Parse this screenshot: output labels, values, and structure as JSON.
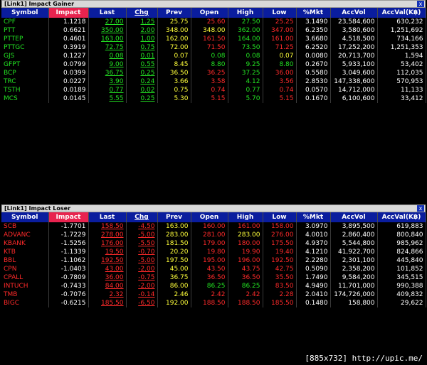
{
  "gainer": {
    "title": "[Link1] Impact Gainer",
    "close": "x",
    "headers": [
      "Symbol",
      "Impact",
      "Last",
      "Chg",
      "Prev",
      "Open",
      "High",
      "Low",
      "%Mkt",
      "AccVol",
      "AccVal(K฿)"
    ],
    "rows": [
      {
        "symbol": "CPF",
        "impact": "1.1218",
        "last": "27.00",
        "chg": "1.25",
        "prev": "25.75",
        "open": "25.60",
        "high": "27.50",
        "low": "25.25",
        "mkt": "3.1490",
        "accvol": "23,584,600",
        "accval": "630,232",
        "last_color": "green",
        "open_color": "red",
        "high_color": "green",
        "low_color": "red"
      },
      {
        "symbol": "PTT",
        "impact": "0.6621",
        "last": "350.00",
        "chg": "2.00",
        "prev": "348.00",
        "open": "348.00",
        "high": "362.00",
        "low": "347.00",
        "mkt": "6.2350",
        "accvol": "3,580,600",
        "accval": "1,251,692",
        "last_color": "green",
        "open_color": "yellow",
        "high_color": "green",
        "low_color": "red"
      },
      {
        "symbol": "PTTEP",
        "impact": "0.4601",
        "last": "163.00",
        "chg": "1.00",
        "prev": "162.00",
        "open": "161.50",
        "high": "164.00",
        "low": "161.00",
        "mkt": "3.6680",
        "accvol": "4,518,500",
        "accval": "734,166",
        "last_color": "green",
        "open_color": "red",
        "high_color": "green",
        "low_color": "red"
      },
      {
        "symbol": "PTTGC",
        "impact": "0.3919",
        "last": "72.75",
        "chg": "0.75",
        "prev": "72.00",
        "open": "71.50",
        "high": "73.50",
        "low": "71.25",
        "mkt": "6.2520",
        "accvol": "17,252,200",
        "accval": "1,251,353",
        "last_color": "green",
        "open_color": "red",
        "high_color": "green",
        "low_color": "red"
      },
      {
        "symbol": "GJS",
        "impact": "0.1227",
        "last": "0.08",
        "chg": "0.01",
        "prev": "0.07",
        "open": "0.08",
        "high": "0.08",
        "low": "0.07",
        "mkt": "0.0080",
        "accvol": "20,713,700",
        "accval": "1,594",
        "last_color": "green",
        "open_color": "green",
        "high_color": "green",
        "low_color": "yellow"
      },
      {
        "symbol": "GFPT",
        "impact": "0.0799",
        "last": "9.00",
        "chg": "0.55",
        "prev": "8.45",
        "open": "8.80",
        "high": "9.25",
        "low": "8.80",
        "mkt": "0.2670",
        "accvol": "5,933,100",
        "accval": "53,402",
        "last_color": "green",
        "open_color": "green",
        "high_color": "green",
        "low_color": "green"
      },
      {
        "symbol": "BCP",
        "impact": "0.0399",
        "last": "36.75",
        "chg": "0.25",
        "prev": "36.50",
        "open": "36.25",
        "high": "37.25",
        "low": "36.00",
        "mkt": "0.5580",
        "accvol": "3,049,600",
        "accval": "112,035",
        "last_color": "green",
        "open_color": "red",
        "high_color": "green",
        "low_color": "red"
      },
      {
        "symbol": "TRC",
        "impact": "0.0227",
        "last": "3.90",
        "chg": "0.24",
        "prev": "3.66",
        "open": "3.58",
        "high": "4.12",
        "low": "3.56",
        "mkt": "2.8530",
        "accvol": "147,338,600",
        "accval": "570,953",
        "last_color": "green",
        "open_color": "red",
        "high_color": "green",
        "low_color": "red"
      },
      {
        "symbol": "TSTH",
        "impact": "0.0189",
        "last": "0.77",
        "chg": "0.02",
        "prev": "0.75",
        "open": "0.74",
        "high": "0.77",
        "low": "0.74",
        "mkt": "0.0570",
        "accvol": "14,712,000",
        "accval": "11,133",
        "last_color": "green",
        "open_color": "red",
        "high_color": "green",
        "low_color": "red"
      },
      {
        "symbol": "MCS",
        "impact": "0.0145",
        "last": "5.55",
        "chg": "0.25",
        "prev": "5.30",
        "open": "5.15",
        "high": "5.70",
        "low": "5.15",
        "mkt": "0.1670",
        "accvol": "6,100,600",
        "accval": "33,412",
        "last_color": "green",
        "open_color": "red",
        "high_color": "green",
        "low_color": "red"
      }
    ]
  },
  "loser": {
    "title": "[Link1] Impact Loser",
    "close": "x",
    "headers": [
      "Symbol",
      "Impact",
      "Last",
      "Chg",
      "Prev",
      "Open",
      "High",
      "Low",
      "%Mkt",
      "AccVol",
      "AccVal(K฿)"
    ],
    "rows": [
      {
        "symbol": "SCB",
        "impact": "-1.7701",
        "last": "158.50",
        "chg": "-4.50",
        "prev": "163.00",
        "open": "160.00",
        "high": "161.00",
        "low": "158.00",
        "mkt": "3.0970",
        "accvol": "3,895,500",
        "accval": "619,883",
        "last_color": "red",
        "open_color": "red",
        "high_color": "red",
        "low_color": "red"
      },
      {
        "symbol": "ADVANC",
        "impact": "-1.7229",
        "last": "278.00",
        "chg": "-5.00",
        "prev": "283.00",
        "open": "281.00",
        "high": "283.00",
        "low": "276.00",
        "mkt": "4.0010",
        "accvol": "2,860,400",
        "accval": "800,840",
        "last_color": "red",
        "open_color": "red",
        "high_color": "yellow",
        "low_color": "red"
      },
      {
        "symbol": "KBANK",
        "impact": "-1.5256",
        "last": "176.00",
        "chg": "-5.50",
        "prev": "181.50",
        "open": "179.00",
        "high": "180.00",
        "low": "175.50",
        "mkt": "4.9370",
        "accvol": "5,544,800",
        "accval": "985,962",
        "last_color": "red",
        "open_color": "red",
        "high_color": "red",
        "low_color": "red"
      },
      {
        "symbol": "KTB",
        "impact": "-1.1339",
        "last": "19.50",
        "chg": "-0.70",
        "prev": "20.20",
        "open": "19.80",
        "high": "19.90",
        "low": "19.40",
        "mkt": "4.1210",
        "accvol": "41,922,700",
        "accval": "824,866",
        "last_color": "red",
        "open_color": "red",
        "high_color": "red",
        "low_color": "red"
      },
      {
        "symbol": "BBL",
        "impact": "-1.1062",
        "last": "192.50",
        "chg": "-5.00",
        "prev": "197.50",
        "open": "195.00",
        "high": "196.00",
        "low": "192.50",
        "mkt": "2.2280",
        "accvol": "2,301,100",
        "accval": "445,840",
        "last_color": "red",
        "open_color": "red",
        "high_color": "red",
        "low_color": "red"
      },
      {
        "symbol": "CPN",
        "impact": "-1.0403",
        "last": "43.00",
        "chg": "-2.00",
        "prev": "45.00",
        "open": "43.50",
        "high": "43.75",
        "low": "42.75",
        "mkt": "0.5090",
        "accvol": "2,358,200",
        "accval": "101,852",
        "last_color": "red",
        "open_color": "red",
        "high_color": "red",
        "low_color": "red"
      },
      {
        "symbol": "CPALL",
        "impact": "-0.7809",
        "last": "36.00",
        "chg": "-0.75",
        "prev": "36.75",
        "open": "36.50",
        "high": "36.50",
        "low": "35.50",
        "mkt": "1.7490",
        "accvol": "9,584,200",
        "accval": "345,515",
        "last_color": "red",
        "open_color": "red",
        "high_color": "red",
        "low_color": "red"
      },
      {
        "symbol": "INTUCH",
        "impact": "-0.7433",
        "last": "84.00",
        "chg": "-2.00",
        "prev": "86.00",
        "open": "86.25",
        "high": "86.25",
        "low": "83.50",
        "mkt": "4.9490",
        "accvol": "11,701,000",
        "accval": "990,388",
        "last_color": "red",
        "open_color": "green",
        "high_color": "green",
        "low_color": "red"
      },
      {
        "symbol": "TMB",
        "impact": "-0.7076",
        "last": "2.32",
        "chg": "-0.14",
        "prev": "2.46",
        "open": "2.42",
        "high": "2.42",
        "low": "2.28",
        "mkt": "2.0410",
        "accvol": "174,726,000",
        "accval": "409,832",
        "last_color": "red",
        "open_color": "red",
        "high_color": "red",
        "low_color": "red"
      },
      {
        "symbol": "BIGC",
        "impact": "-0.6215",
        "last": "185.50",
        "chg": "-6.50",
        "prev": "192.00",
        "open": "188.50",
        "high": "188.50",
        "low": "185.50",
        "mkt": "0.1480",
        "accvol": "158,800",
        "accval": "29,622",
        "last_color": "red",
        "open_color": "red",
        "high_color": "red",
        "low_color": "red"
      }
    ]
  },
  "watermark": "[885x732] http://upic.me/",
  "colors": {
    "header_bg": "#0a1d9e",
    "impact_header": "#e8234f",
    "green": "#22e022",
    "red": "#ff2a2a",
    "yellow": "#ffff3a",
    "titlebar": "#d9d9d9"
  }
}
